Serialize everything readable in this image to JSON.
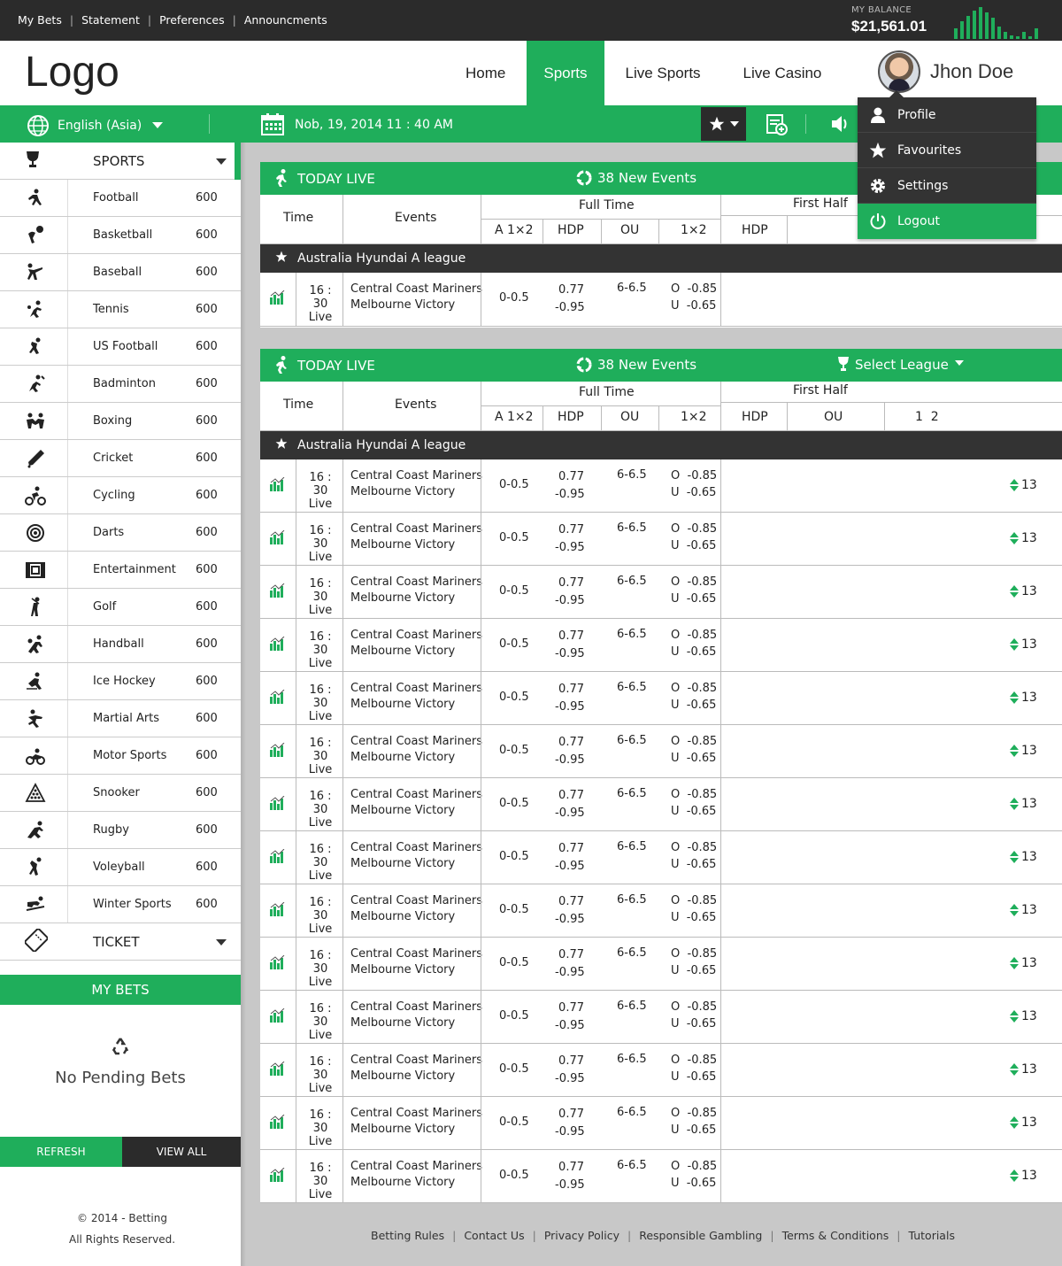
{
  "topnav": [
    {
      "label": "My Bets"
    },
    {
      "label": "Statement"
    },
    {
      "label": "Preferences"
    },
    {
      "label": "Announcments"
    }
  ],
  "balance": {
    "label": "MY BALANCE",
    "value": "$21,561.01"
  },
  "logo": "Logo",
  "mainnav": [
    {
      "label": "Home"
    },
    {
      "label": "Sports"
    },
    {
      "label": "Live Sports"
    },
    {
      "label": "Live Casino"
    }
  ],
  "user": {
    "name": "Jhon Doe"
  },
  "toolbar": {
    "language": "English (Asia)",
    "datetime": "Nob, 19, 2014 11 : 40 AM"
  },
  "user_menu": [
    {
      "label": "Profile",
      "icon": "user-icon"
    },
    {
      "label": "Favourites",
      "icon": "star-icon"
    },
    {
      "label": "Settings",
      "icon": "gear-icon"
    },
    {
      "label": "Logout",
      "icon": "power-icon"
    }
  ],
  "sidebar": {
    "sports_heading": "SPORTS",
    "sports": [
      {
        "name": "Football",
        "count": "600"
      },
      {
        "name": "Basketball",
        "count": "600"
      },
      {
        "name": "Baseball",
        "count": "600"
      },
      {
        "name": "Tennis",
        "count": "600"
      },
      {
        "name": "US Football",
        "count": "600"
      },
      {
        "name": "Badminton",
        "count": "600"
      },
      {
        "name": "Boxing",
        "count": "600"
      },
      {
        "name": "Cricket",
        "count": "600"
      },
      {
        "name": "Cycling",
        "count": "600"
      },
      {
        "name": "Darts",
        "count": "600"
      },
      {
        "name": "Entertainment",
        "count": "600"
      },
      {
        "name": "Golf",
        "count": "600"
      },
      {
        "name": "Handball",
        "count": "600"
      },
      {
        "name": "Ice Hockey",
        "count": "600"
      },
      {
        "name": "Martial Arts",
        "count": "600"
      },
      {
        "name": "Motor Sports",
        "count": "600"
      },
      {
        "name": "Snooker",
        "count": "600"
      },
      {
        "name": "Rugby",
        "count": "600"
      },
      {
        "name": "Voleyball",
        "count": "600"
      },
      {
        "name": "Winter Sports",
        "count": "600"
      }
    ],
    "ticket_heading": "TICKET",
    "mybets_heading": "MY BETS",
    "no_pending": "No Pending Bets",
    "refresh": "REFRESH",
    "view_all": "VIEW ALL",
    "copyright": "© 2014 - Betting",
    "rights": "All Rights Reserved."
  },
  "panel": {
    "title": "TODAY LIVE",
    "new_events": "38 New Events",
    "select_league": "Select League",
    "cols": {
      "time": "Time",
      "events": "Events",
      "full_time": "Full Time",
      "first_half": "First Half",
      "a1x2": "A 1×2",
      "hdp": "HDP",
      "ou": "OU",
      "x12": "1×2",
      "hdp2": "HDP",
      "ou2": "OU",
      "onetwo": "1  2"
    },
    "league": "Australia Hyundai A league"
  },
  "match": {
    "time": "16 : 30",
    "status": "Live",
    "home": "Central Coast Mariners",
    "away": "Melbourne Victory",
    "a1x2": "0-0.5",
    "hdp_top": "0.77",
    "hdp_bot": "-0.95",
    "ou": "6-6.5",
    "ou_o": "O  -0.85",
    "ou_u": "U  -0.65",
    "more": "13"
  },
  "footer": [
    {
      "label": "Betting Rules"
    },
    {
      "label": "Contact Us"
    },
    {
      "label": "Privacy Policy"
    },
    {
      "label": "Responsible Gambling"
    },
    {
      "label": "Terms & Conditions"
    },
    {
      "label": "Tutorials"
    }
  ],
  "colors": {
    "accent": "#1fae5b",
    "dark": "#2b2b2b",
    "background": "#c8c8c8"
  }
}
